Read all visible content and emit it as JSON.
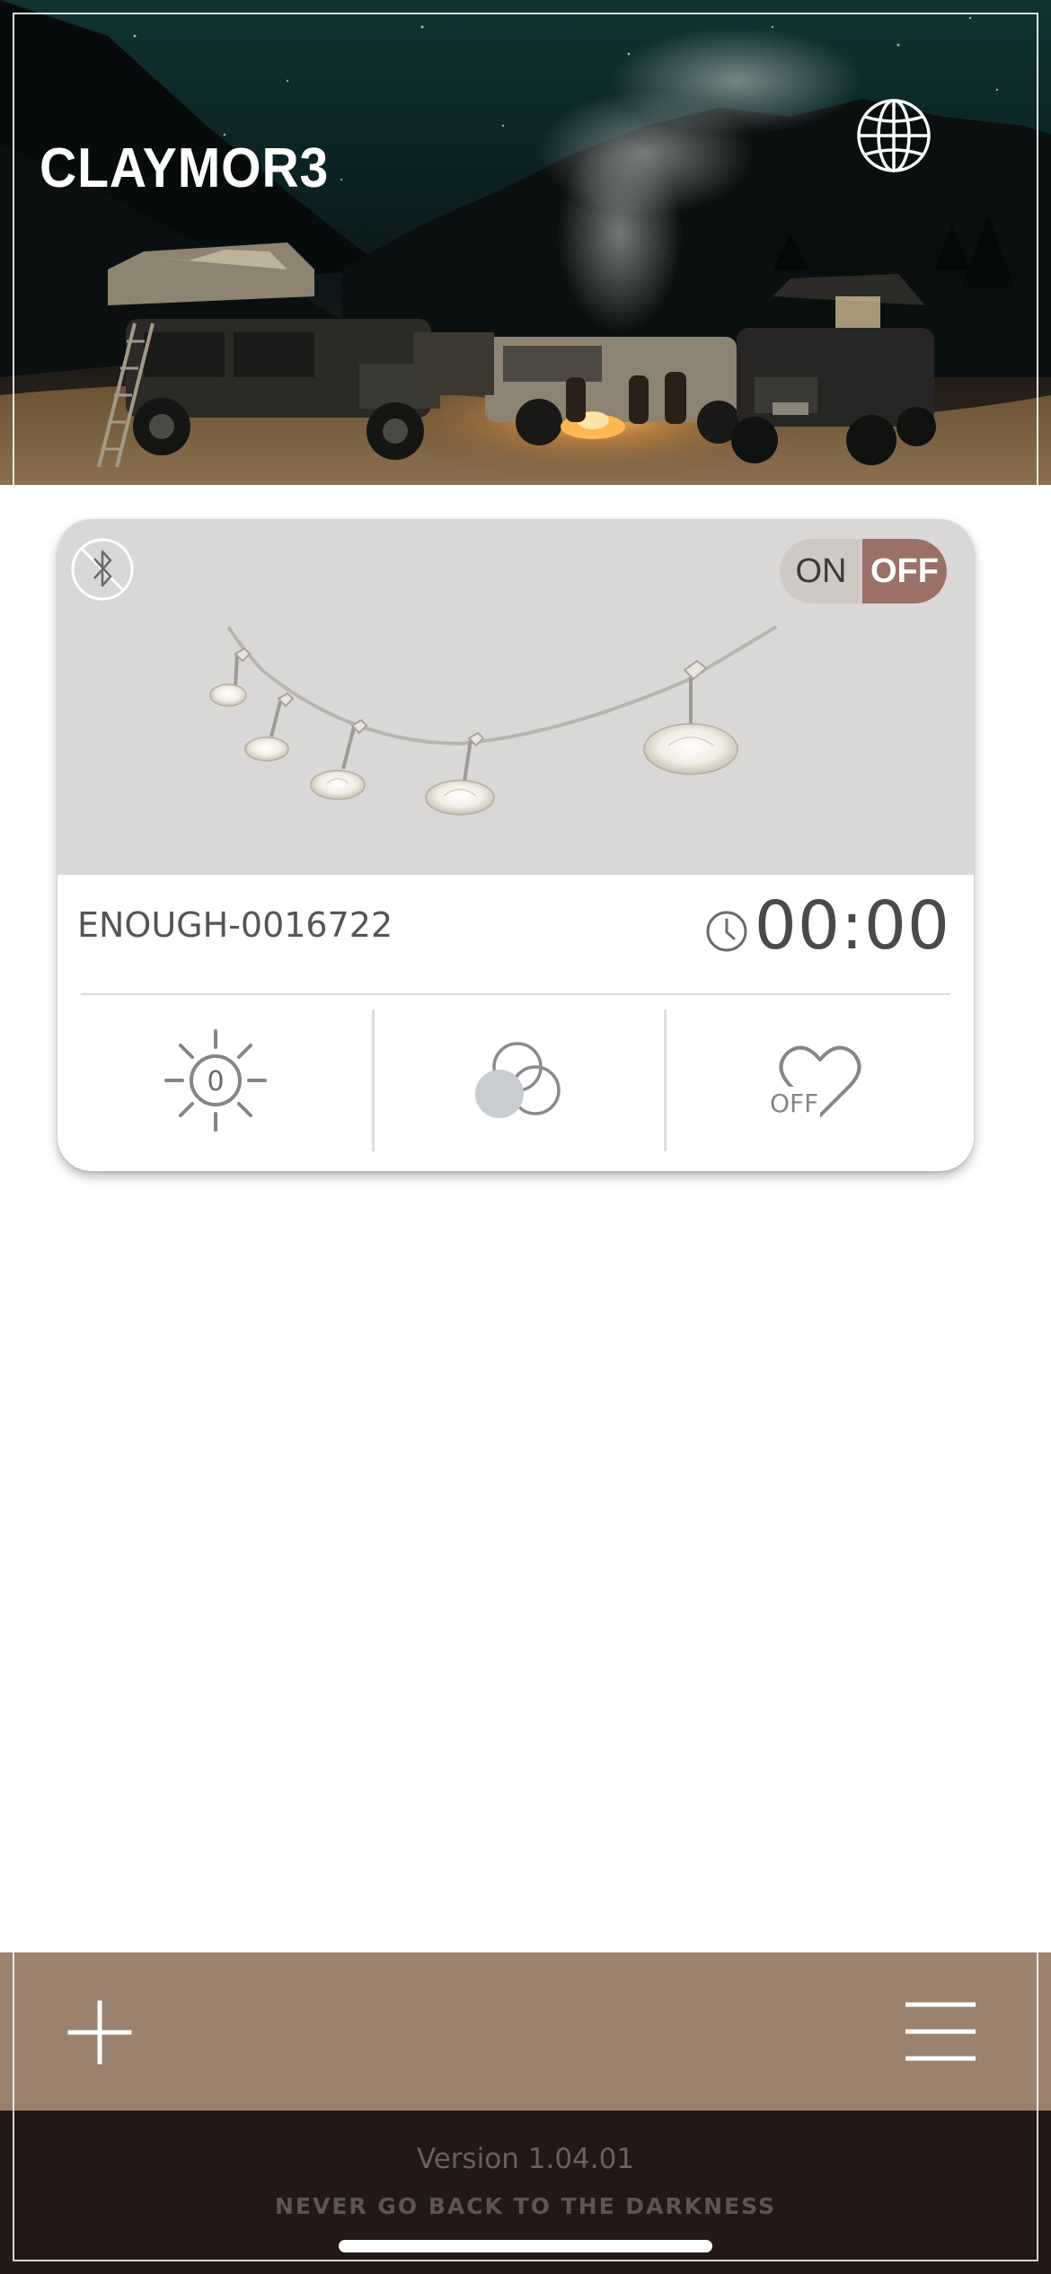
{
  "header": {
    "logo_text": "CLAYMOR3",
    "globe_icon": "globe-icon"
  },
  "device_card": {
    "bluetooth_icon": "bluetooth-icon",
    "power_toggle": {
      "on_label": "ON",
      "off_label": "OFF",
      "state": "OFF"
    },
    "device_name": "ENOUGH-0016722",
    "timer_icon": "clock-icon",
    "timer_value": "00:00",
    "controls": {
      "brightness": {
        "icon": "brightness-icon",
        "value": "0"
      },
      "color": {
        "icon": "color-mix-icon"
      },
      "favorite": {
        "icon": "heart-icon",
        "label": "OFF"
      }
    }
  },
  "bottom_bar": {
    "add_icon": "plus-icon",
    "menu_icon": "hamburger-icon"
  },
  "footer": {
    "version": "Version 1.04.01",
    "tagline": "NEVER GO BACK TO THE DARKNESS"
  },
  "colors": {
    "toggle_off_bg": "#9b7066",
    "bottom_bar_bg": "#9a826e",
    "footer_bg": "#231816",
    "card_image_bg": "#d9d8d7"
  }
}
